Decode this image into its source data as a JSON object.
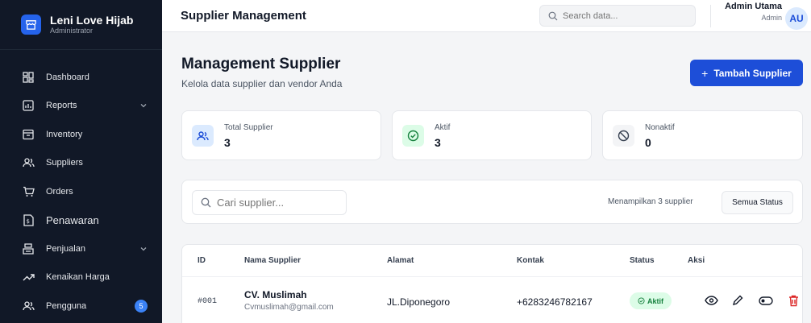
{
  "brand": {
    "name": "Leni Love Hijab",
    "role": "Administrator"
  },
  "sidebar": {
    "items": [
      {
        "label": "Dashboard",
        "icon": "dashboard-icon"
      },
      {
        "label": "Reports",
        "icon": "reports-icon",
        "has_submenu": true
      },
      {
        "label": "Inventory",
        "icon": "inventory-icon"
      },
      {
        "label": "Suppliers",
        "icon": "suppliers-icon"
      },
      {
        "label": "Orders",
        "icon": "cart-icon"
      },
      {
        "label": "Penawaran",
        "icon": "offer-icon"
      },
      {
        "label": "Penjualan",
        "icon": "sales-icon",
        "has_submenu": true
      },
      {
        "label": "Kenaikan Harga",
        "icon": "trend-up-icon"
      },
      {
        "label": "Pengguna",
        "icon": "users-icon",
        "badge": "5"
      }
    ]
  },
  "header": {
    "title": "Supplier Management",
    "search_placeholder": "Search data...",
    "user_name": "Admin Utama",
    "user_role": "Admin",
    "avatar_initials": "AU"
  },
  "main": {
    "title": "Management Supplier",
    "subtitle": "Kelola data supplier dan vendor Anda",
    "add_button": "Tambah Supplier",
    "stats": [
      {
        "label": "Total Supplier",
        "value": "3",
        "icon": "users-icon"
      },
      {
        "label": "Aktif",
        "value": "3",
        "icon": "check-circle-icon"
      },
      {
        "label": "Nonaktif",
        "value": "0",
        "icon": "ban-icon"
      }
    ],
    "filter": {
      "search_placeholder": "Cari supplier...",
      "showing_text": "Menampilkan 3 supplier",
      "status_select": "Semua Status"
    },
    "table": {
      "columns": [
        "ID",
        "Nama Supplier",
        "Alamat",
        "Kontak",
        "Status",
        "Aksi"
      ],
      "rows": [
        {
          "id": "#001",
          "name": "CV. Muslimah",
          "email": "Cvmuslimah@gmail.com",
          "address": "JL.Diponegoro",
          "contact": "+6283246782167",
          "status": "Aktif"
        }
      ]
    }
  },
  "colors": {
    "sidebar_bg": "#111827",
    "primary": "#1d4ed8",
    "active_green": "#15803d",
    "danger": "#dc2626"
  }
}
